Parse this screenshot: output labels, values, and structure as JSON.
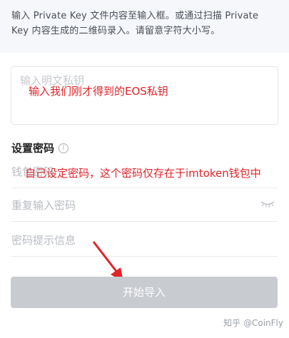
{
  "tip": {
    "line1": "输入 Private Key 文件内容至输入框。或通过扫描 Private",
    "line2": "Key 内容生成的二维码录入。请留意字符大小写。"
  },
  "private_key": {
    "placeholder": "输入明文私钥",
    "annotation": "输入我们刚才得到的EOS私钥"
  },
  "password_section": {
    "title": "设置密码",
    "info_icon": "info-icon",
    "password_placeholder": "钱包密码",
    "password_annotation": "自己设定密码，这个密码仅存在于imtoken钱包中",
    "repeat_placeholder": "重复输入密码",
    "eye_icon": "eye-closed-icon",
    "hint_placeholder": "密码提示信息"
  },
  "import_button": {
    "label": "开始导入"
  },
  "watermark": "知乎 @CoinFly",
  "colors": {
    "annotation": "#e0242a",
    "button_disabled": "#c8cbd0",
    "banner_bg": "#f5f7fa"
  }
}
